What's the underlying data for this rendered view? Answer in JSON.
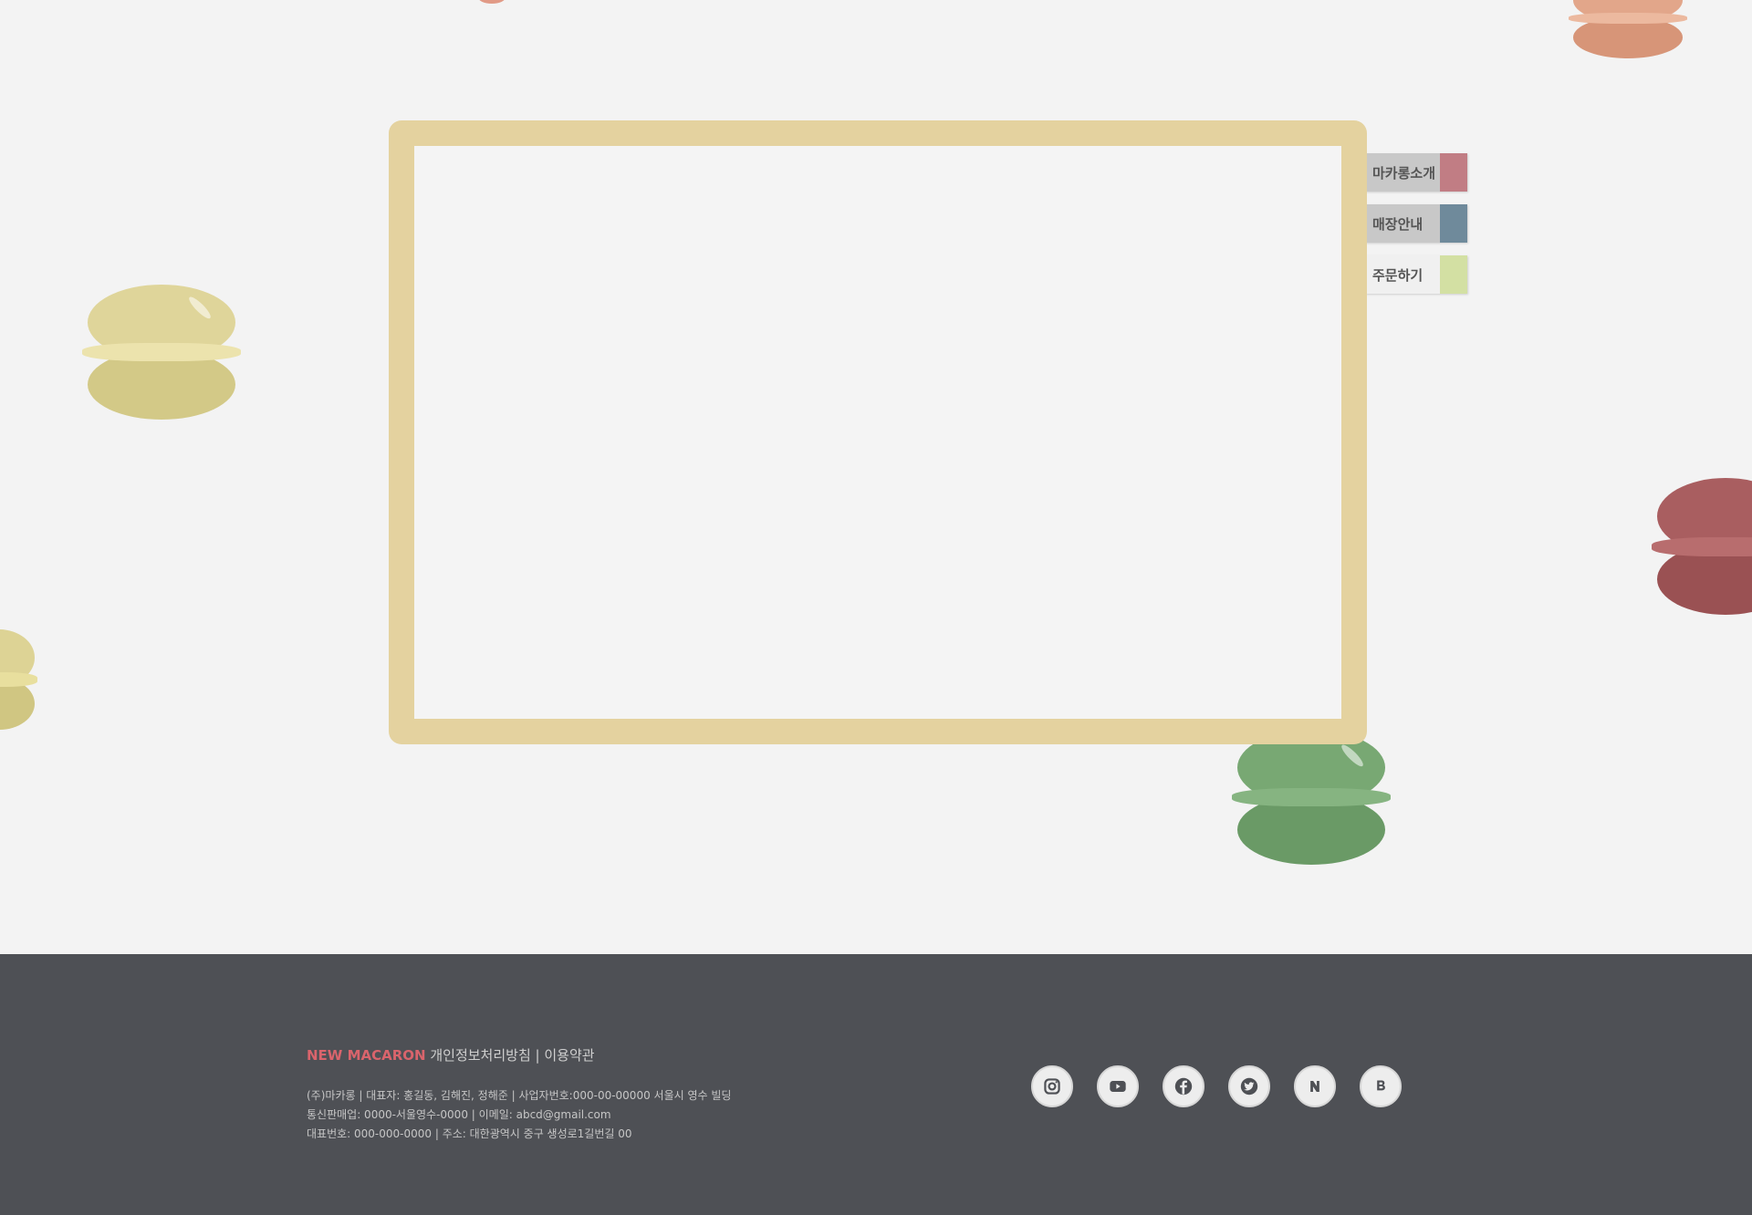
{
  "footer": {
    "brand": "NEW MACARON",
    "links": "개인정보처리방침 | 이용약관",
    "info_lines": [
      "(주)마카롱 | 대표자: 홍길동, 김해진, 정해준 | 사업자번호:000-00-00000 서울시 영수 빌딩",
      "통신판매업: 0000-서울영수-0000 | 이메일: abcd@gmail.com",
      "대표번호: 000-000-0000 | 주소: 대한광역시 중구 생성로1길번길 00"
    ]
  },
  "side_tabs": [
    {
      "label": "마카롱소개",
      "color": "#c17d84"
    },
    {
      "label": "매장안내",
      "color": "#6f8a9b"
    },
    {
      "label": "주문하기",
      "color": "#d3e0a3"
    }
  ],
  "social_icons": [
    "instagram-icon",
    "youtube-icon",
    "facebook-icon",
    "twitter-icon",
    "naver-icon",
    "blog-icon"
  ],
  "colors": {
    "background": "#f3f3f3",
    "board_frame": "#e4d29f",
    "footer_bg": "#4e5055",
    "brand_red": "#d9646c"
  }
}
